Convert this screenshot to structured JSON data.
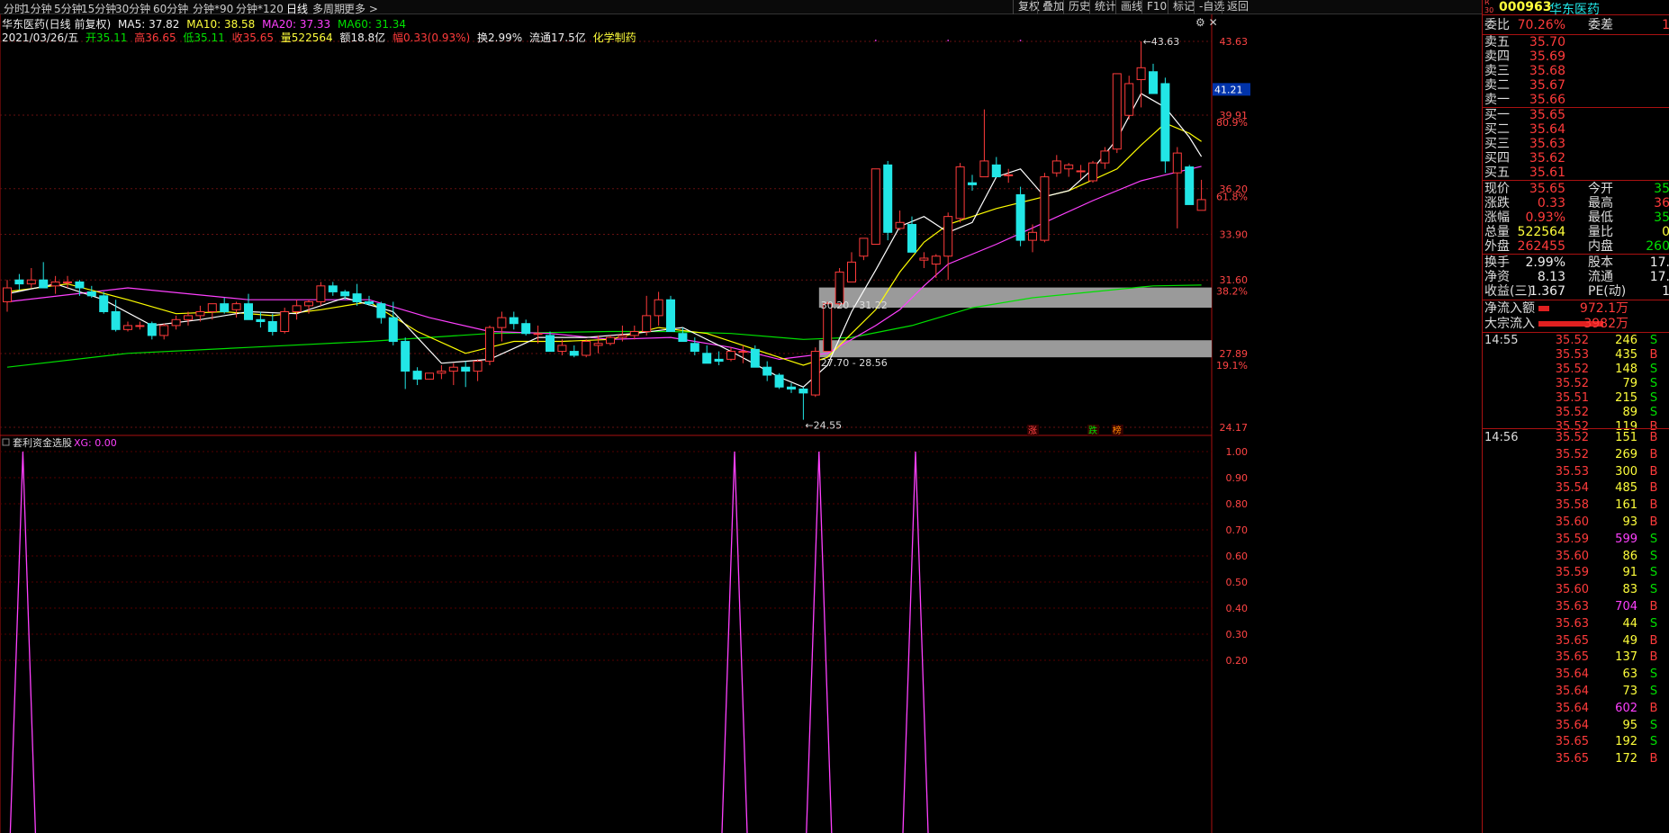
{
  "periods": [
    "分时",
    "1分钟",
    "5分钟",
    "15分钟",
    "30分钟",
    "60分钟",
    "分钟*90",
    "分钟*120",
    "日线",
    "多周期",
    "更多 >"
  ],
  "active_period": "日线",
  "tools": [
    "复权",
    "叠加",
    "历史",
    "统计",
    "画线",
    "F10",
    "标记",
    "-自选",
    "返回"
  ],
  "info_line1": {
    "name": "华东医药(日线 前复权)",
    "ma5": "MA5: 37.82",
    "ma10": "MA10: 38.58",
    "ma20": "MA20: 37.33",
    "ma60": "MA60: 31.34"
  },
  "info_line2": {
    "date": "2021/03/26/五",
    "open": "开35.11",
    "high": "高36.65",
    "low": "低35.11",
    "close": "收35.65",
    "vol": "量522564",
    "amount": "额18.8亿",
    "change": "幅0.33(0.93%)",
    "turnover": "换2.99%",
    "float": "流通17.5亿",
    "sector": "化学制药"
  },
  "indicator": {
    "name": "套利资金选股",
    "value": "XG: 0.00"
  },
  "colors": {
    "up": "#ff3b3b",
    "down": "#22e6e6",
    "ma5": "#ffffff",
    "ma10": "#ffff00",
    "ma20": "#ff40ff",
    "ma60": "#00e000",
    "xg": "#ff40ff",
    "zone": "#9a9a9a"
  },
  "price_axis": {
    "labels": [
      {
        "v": "43.63",
        "p": 43.63
      },
      {
        "v": "39.91",
        "p": 39.91
      },
      {
        "v": "36.20",
        "p": 36.2
      },
      {
        "v": "33.90",
        "p": 33.9
      },
      {
        "v": "31.60",
        "p": 31.6
      },
      {
        "v": "27.89",
        "p": 27.89
      },
      {
        "v": "24.17",
        "p": 24.17
      }
    ],
    "pct_labels": [
      {
        "v": "80.9%",
        "p": 39.55
      },
      {
        "v": "61.8%",
        "p": 35.8
      },
      {
        "v": "38.2%",
        "p": 31.05
      },
      {
        "v": "19.1%",
        "p": 27.3
      }
    ],
    "highlight": {
      "v": "41.21",
      "p": 41.21
    }
  },
  "indicator_axis": [
    "1.00",
    "0.90",
    "0.80",
    "0.70",
    "0.60",
    "0.50",
    "0.40",
    "0.30",
    "0.20"
  ],
  "chart_data": {
    "type": "candlestick",
    "price_range": [
      24.17,
      43.63
    ],
    "ohlc": [
      [
        30.5,
        31.6,
        30.0,
        31.2
      ],
      [
        31.6,
        31.9,
        31.1,
        31.4
      ],
      [
        31.4,
        32.2,
        31.2,
        31.6
      ],
      [
        31.6,
        32.5,
        31.3,
        31.2
      ],
      [
        31.3,
        31.8,
        30.9,
        31.5
      ],
      [
        31.5,
        31.8,
        31.2,
        31.5
      ],
      [
        31.5,
        31.6,
        30.8,
        31.2
      ],
      [
        31.0,
        31.3,
        30.7,
        30.8
      ],
      [
        30.8,
        31.0,
        29.9,
        30.0
      ],
      [
        30.0,
        30.6,
        29.0,
        29.1
      ],
      [
        29.1,
        29.5,
        29.0,
        29.3
      ],
      [
        29.3,
        29.5,
        29.1,
        29.3
      ],
      [
        29.4,
        29.5,
        28.6,
        28.8
      ],
      [
        28.8,
        29.4,
        28.6,
        29.3
      ],
      [
        29.3,
        29.8,
        29.1,
        29.6
      ],
      [
        29.6,
        30.0,
        29.3,
        29.8
      ],
      [
        29.8,
        30.3,
        29.5,
        30.0
      ],
      [
        30.0,
        30.4,
        29.6,
        30.4
      ],
      [
        30.4,
        30.7,
        29.9,
        30.0
      ],
      [
        30.1,
        30.5,
        29.7,
        30.4
      ],
      [
        30.4,
        30.9,
        29.8,
        29.6
      ],
      [
        29.6,
        30.0,
        29.2,
        29.5
      ],
      [
        29.5,
        29.9,
        28.8,
        29.0
      ],
      [
        29.0,
        30.2,
        28.9,
        30.0
      ],
      [
        30.0,
        30.6,
        29.6,
        30.3
      ],
      [
        30.3,
        30.6,
        29.9,
        30.5
      ],
      [
        30.5,
        31.5,
        30.3,
        31.3
      ],
      [
        31.3,
        31.5,
        30.8,
        31.0
      ],
      [
        31.0,
        31.1,
        30.6,
        30.8
      ],
      [
        30.9,
        31.4,
        30.3,
        30.5
      ],
      [
        30.5,
        30.8,
        30.3,
        30.4
      ],
      [
        30.4,
        30.5,
        29.4,
        29.7
      ],
      [
        29.7,
        30.5,
        28.3,
        28.5
      ],
      [
        28.5,
        28.7,
        26.1,
        27.0
      ],
      [
        27.0,
        27.2,
        26.3,
        26.6
      ],
      [
        26.6,
        26.9,
        26.6,
        26.9
      ],
      [
        26.9,
        27.3,
        26.6,
        27.0
      ],
      [
        27.0,
        27.4,
        26.3,
        27.2
      ],
      [
        27.2,
        27.5,
        26.2,
        27.0
      ],
      [
        27.0,
        27.6,
        26.5,
        27.5
      ],
      [
        27.5,
        29.3,
        27.3,
        29.2
      ],
      [
        29.2,
        30.0,
        28.5,
        29.7
      ],
      [
        29.7,
        30.0,
        29.1,
        29.4
      ],
      [
        29.4,
        29.6,
        28.8,
        28.9
      ],
      [
        28.9,
        29.3,
        28.4,
        28.9
      ],
      [
        28.8,
        29.0,
        28.0,
        28.0
      ],
      [
        28.0,
        28.6,
        27.8,
        28.3
      ],
      [
        28.0,
        28.3,
        27.7,
        27.8
      ],
      [
        27.8,
        28.6,
        27.7,
        28.5
      ],
      [
        28.3,
        28.8,
        27.9,
        28.4
      ],
      [
        28.4,
        28.8,
        28.3,
        28.7
      ],
      [
        28.7,
        29.3,
        28.5,
        28.8
      ],
      [
        28.8,
        29.3,
        28.6,
        29.0
      ],
      [
        29.0,
        30.8,
        28.8,
        29.8
      ],
      [
        29.8,
        31.0,
        29.3,
        30.6
      ],
      [
        30.6,
        30.8,
        29.4,
        29.0
      ],
      [
        28.9,
        29.2,
        28.7,
        28.5
      ],
      [
        28.4,
        28.7,
        27.8,
        28.0
      ],
      [
        27.9,
        28.3,
        27.4,
        27.4
      ],
      [
        27.6,
        28.0,
        27.3,
        27.5
      ],
      [
        27.6,
        28.2,
        27.5,
        28.0
      ],
      [
        28.0,
        28.3,
        27.4,
        28.0
      ],
      [
        28.1,
        28.3,
        27.2,
        27.2
      ],
      [
        27.2,
        27.5,
        26.5,
        26.8
      ],
      [
        26.8,
        26.9,
        26.1,
        26.2
      ],
      [
        26.2,
        26.4,
        25.9,
        26.1
      ],
      [
        26.1,
        26.2,
        24.55,
        25.9
      ],
      [
        25.8,
        28.2,
        25.7,
        28.0
      ],
      [
        28.0,
        30.5,
        28.0,
        30.4
      ],
      [
        30.4,
        32.2,
        30.3,
        32.0
      ],
      [
        31.5,
        33.0,
        31.5,
        32.5
      ],
      [
        32.8,
        33.6,
        32.6,
        33.7
      ],
      [
        33.4,
        37.2,
        33.4,
        37.2
      ],
      [
        37.4,
        37.6,
        33.6,
        34.0
      ],
      [
        34.2,
        35.1,
        34.1,
        34.5
      ],
      [
        34.4,
        34.8,
        33.3,
        33.0
      ],
      [
        32.6,
        33.0,
        32.2,
        32.7
      ],
      [
        32.4,
        32.9,
        31.7,
        32.8
      ],
      [
        32.8,
        35.0,
        31.6,
        34.8
      ],
      [
        34.7,
        37.5,
        34.5,
        37.3
      ],
      [
        36.5,
        36.9,
        36.1,
        36.4
      ],
      [
        36.8,
        40.2,
        36.8,
        37.6
      ],
      [
        37.4,
        37.8,
        37.2,
        36.8
      ],
      [
        36.9,
        37.2,
        36.5,
        36.9
      ],
      [
        35.9,
        36.3,
        33.3,
        33.6
      ],
      [
        33.6,
        34.4,
        33.0,
        34.0
      ],
      [
        33.6,
        37.0,
        33.5,
        36.8
      ],
      [
        37.0,
        37.9,
        36.8,
        37.6
      ],
      [
        37.2,
        37.5,
        36.8,
        37.4
      ],
      [
        37.1,
        37.4,
        36.7,
        37.1
      ],
      [
        36.6,
        37.6,
        36.5,
        37.5
      ],
      [
        37.5,
        38.3,
        37.2,
        38.1
      ],
      [
        38.2,
        41.9,
        38.0,
        42.0
      ],
      [
        39.9,
        41.9,
        39.7,
        41.5
      ],
      [
        41.7,
        43.63,
        40.3,
        42.3
      ],
      [
        42.1,
        42.5,
        41.6,
        41.0
      ],
      [
        41.5,
        41.8,
        37.0,
        37.6
      ],
      [
        37.0,
        38.3,
        34.2,
        38.0
      ],
      [
        37.3,
        37.4,
        35.5,
        35.4
      ],
      [
        35.11,
        36.65,
        35.11,
        35.65
      ]
    ],
    "ma5": [
      [
        0,
        30.9
      ],
      [
        4,
        31.4
      ],
      [
        8,
        30.6
      ],
      [
        12,
        29.3
      ],
      [
        16,
        29.6
      ],
      [
        20,
        30.0
      ],
      [
        24,
        29.9
      ],
      [
        28,
        30.7
      ],
      [
        32,
        30.0
      ],
      [
        36,
        27.4
      ],
      [
        40,
        27.6
      ],
      [
        44,
        28.7
      ],
      [
        48,
        28.7
      ],
      [
        52,
        28.9
      ],
      [
        56,
        29.2
      ],
      [
        60,
        28.0
      ],
      [
        64,
        26.7
      ],
      [
        66,
        26.2
      ],
      [
        68,
        27.3
      ],
      [
        70,
        30.0
      ],
      [
        72,
        32.1
      ],
      [
        74,
        34.3
      ],
      [
        76,
        34.8
      ],
      [
        78,
        34.0
      ],
      [
        80,
        34.5
      ],
      [
        82,
        36.8
      ],
      [
        84,
        37.2
      ],
      [
        86,
        35.8
      ],
      [
        88,
        36.1
      ],
      [
        90,
        37.2
      ],
      [
        92,
        38.7
      ],
      [
        94,
        41.0
      ],
      [
        96,
        40.3
      ],
      [
        98,
        38.8
      ],
      [
        99,
        37.82
      ]
    ],
    "ma10": [
      [
        0,
        31.0
      ],
      [
        5,
        31.4
      ],
      [
        10,
        30.6
      ],
      [
        14,
        29.9
      ],
      [
        18,
        30.0
      ],
      [
        22,
        29.8
      ],
      [
        26,
        30.1
      ],
      [
        30,
        30.5
      ],
      [
        34,
        29.0
      ],
      [
        38,
        27.9
      ],
      [
        42,
        28.5
      ],
      [
        46,
        28.5
      ],
      [
        50,
        28.6
      ],
      [
        54,
        29.2
      ],
      [
        58,
        28.9
      ],
      [
        62,
        28.1
      ],
      [
        66,
        27.3
      ],
      [
        68,
        27.7
      ],
      [
        72,
        30.1
      ],
      [
        74,
        32.0
      ],
      [
        76,
        33.5
      ],
      [
        78,
        34.4
      ],
      [
        82,
        35.2
      ],
      [
        86,
        35.8
      ],
      [
        88,
        36.1
      ],
      [
        92,
        37.2
      ],
      [
        94,
        38.4
      ],
      [
        96,
        39.5
      ],
      [
        98,
        39.0
      ],
      [
        99,
        38.58
      ]
    ],
    "ma20": [
      [
        0,
        30.5
      ],
      [
        10,
        31.2
      ],
      [
        20,
        30.6
      ],
      [
        30,
        30.6
      ],
      [
        35,
        29.7
      ],
      [
        40,
        29.0
      ],
      [
        45,
        28.9
      ],
      [
        50,
        28.6
      ],
      [
        55,
        28.7
      ],
      [
        60,
        28.2
      ],
      [
        64,
        27.6
      ],
      [
        68,
        27.9
      ],
      [
        72,
        29.3
      ],
      [
        74,
        30.1
      ],
      [
        76,
        31.3
      ],
      [
        78,
        32.4
      ],
      [
        82,
        33.4
      ],
      [
        86,
        34.5
      ],
      [
        90,
        35.6
      ],
      [
        94,
        36.6
      ],
      [
        96,
        36.9
      ],
      [
        99,
        37.33
      ]
    ],
    "ma60": [
      [
        0,
        27.2
      ],
      [
        10,
        27.9
      ],
      [
        20,
        28.2
      ],
      [
        30,
        28.5
      ],
      [
        40,
        28.9
      ],
      [
        50,
        29.0
      ],
      [
        55,
        29.0
      ],
      [
        60,
        28.9
      ],
      [
        66,
        28.6
      ],
      [
        70,
        28.7
      ],
      [
        75,
        29.3
      ],
      [
        80,
        30.2
      ],
      [
        85,
        30.7
      ],
      [
        90,
        31.0
      ],
      [
        95,
        31.3
      ],
      [
        99,
        31.34
      ]
    ],
    "zones": [
      {
        "label": "30.20 - 31.22",
        "low": 30.2,
        "high": 31.22,
        "from": 67
      },
      {
        "label": "27.70 - 28.56",
        "low": 27.7,
        "high": 28.56,
        "from": 67
      }
    ],
    "annotations": [
      {
        "label": "43.63",
        "bar": 94,
        "price": 43.63
      },
      {
        "label": "24.55",
        "bar": 66,
        "price": 24.55
      }
    ],
    "signal_tags": [
      {
        "label": "涨",
        "bar": 85
      },
      {
        "label": "跌",
        "bar": 90
      },
      {
        "label": "榜",
        "bar": 92
      }
    ],
    "xg_spikes": [
      1,
      60,
      67,
      75
    ]
  },
  "sidebar": {
    "code": "000963",
    "name": "华东医药",
    "webi": {
      "label": "委比",
      "value": "70.26%",
      "label2": "委差",
      "value2": "1"
    },
    "sells": [
      {
        "label": "卖五",
        "price": "35.70"
      },
      {
        "label": "卖四",
        "price": "35.69"
      },
      {
        "label": "卖三",
        "price": "35.68"
      },
      {
        "label": "卖二",
        "price": "35.67"
      },
      {
        "label": "卖一",
        "price": "35.66"
      }
    ],
    "buys": [
      {
        "label": "买一",
        "price": "35.65"
      },
      {
        "label": "买二",
        "price": "35.64"
      },
      {
        "label": "买三",
        "price": "35.63"
      },
      {
        "label": "买四",
        "price": "35.62"
      },
      {
        "label": "买五",
        "price": "35.61"
      }
    ],
    "quote": [
      {
        "l": "现价",
        "v": "35.65",
        "vc": "r",
        "l2": "今开",
        "v2": "35",
        "vc2": "g"
      },
      {
        "l": "涨跌",
        "v": "0.33",
        "vc": "r",
        "l2": "最高",
        "v2": "36",
        "vc2": "r"
      },
      {
        "l": "涨幅",
        "v": "0.93%",
        "vc": "r",
        "l2": "最低",
        "v2": "35",
        "vc2": "g"
      },
      {
        "l": "总量",
        "v": "522564",
        "vc": "y",
        "l2": "量比",
        "v2": "0",
        "vc2": "y"
      },
      {
        "l": "外盘",
        "v": "262455",
        "vc": "r",
        "l2": "内盘",
        "v2": "260",
        "vc2": "g"
      }
    ],
    "stats": [
      {
        "l": "换手",
        "v": "2.99%",
        "l2": "股本",
        "v2": "17."
      },
      {
        "l": "净资",
        "v": "8.13",
        "l2": "流通",
        "v2": "17."
      },
      {
        "l": "收益(三)",
        "v": "1.367",
        "l2": "PE(动)",
        "v2": "1"
      }
    ],
    "flows": [
      {
        "label": "净流入额",
        "value": "972.1万"
      },
      {
        "label": "大宗流入",
        "value": "3982万"
      }
    ],
    "ticks": [
      {
        "t": "14:55",
        "p": "35.52",
        "q": "246",
        "s": "S"
      },
      {
        "t": "",
        "p": "35.53",
        "q": "435",
        "s": "B"
      },
      {
        "t": "",
        "p": "35.52",
        "q": "148",
        "s": "S"
      },
      {
        "t": "",
        "p": "35.52",
        "q": "79",
        "s": "S"
      },
      {
        "t": "",
        "p": "35.51",
        "q": "215",
        "s": "S"
      },
      {
        "t": "",
        "p": "35.52",
        "q": "89",
        "s": "S"
      },
      {
        "t": "",
        "p": "35.52",
        "q": "119",
        "s": "B"
      },
      {
        "t": "14:56",
        "p": "35.52",
        "q": "151",
        "s": "B"
      },
      {
        "t": "",
        "p": "35.52",
        "q": "269",
        "s": "B"
      },
      {
        "t": "",
        "p": "35.53",
        "q": "300",
        "s": "B"
      },
      {
        "t": "",
        "p": "35.54",
        "q": "485",
        "s": "B"
      },
      {
        "t": "",
        "p": "35.58",
        "q": "161",
        "s": "B"
      },
      {
        "t": "",
        "p": "35.60",
        "q": "93",
        "s": "B"
      },
      {
        "t": "",
        "p": "35.59",
        "q": "599",
        "s": "S"
      },
      {
        "t": "",
        "p": "35.60",
        "q": "86",
        "s": "S"
      },
      {
        "t": "",
        "p": "35.59",
        "q": "91",
        "s": "S"
      },
      {
        "t": "",
        "p": "35.60",
        "q": "83",
        "s": "S"
      },
      {
        "t": "",
        "p": "35.63",
        "q": "704",
        "s": "B"
      },
      {
        "t": "",
        "p": "35.63",
        "q": "44",
        "s": "S"
      },
      {
        "t": "",
        "p": "35.65",
        "q": "49",
        "s": "B"
      },
      {
        "t": "",
        "p": "35.65",
        "q": "137",
        "s": "B"
      },
      {
        "t": "",
        "p": "35.64",
        "q": "63",
        "s": "S"
      },
      {
        "t": "",
        "p": "35.64",
        "q": "73",
        "s": "S"
      },
      {
        "t": "",
        "p": "35.64",
        "q": "602",
        "s": "B"
      },
      {
        "t": "",
        "p": "35.64",
        "q": "95",
        "s": "S"
      },
      {
        "t": "",
        "p": "35.65",
        "q": "192",
        "s": "S"
      },
      {
        "t": "",
        "p": "35.65",
        "q": "172",
        "s": "B"
      }
    ]
  }
}
